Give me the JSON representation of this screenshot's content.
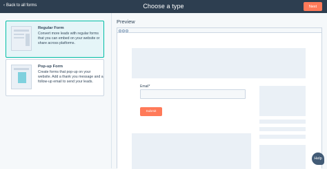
{
  "header": {
    "back_label": "Back to all forms",
    "title": "Choose a type",
    "next_label": "Next"
  },
  "form_types": [
    {
      "title": "Regular Form",
      "description": "Convert more leads with regular forms that you can embed on your website or share across platforms.",
      "selected": true
    },
    {
      "title": "Pop-up Form",
      "description": "Create forms that pop-up on your website. Add a thank you message and a follow-up email to send your leads.",
      "selected": false
    }
  ],
  "preview": {
    "title": "Preview",
    "email_label": "Email*",
    "submit_label": "Submit"
  },
  "help": {
    "label": "Help"
  },
  "colors": {
    "topbar": "#2d3e50",
    "accent": "#ff7a59",
    "selected_bg": "#e5f5f8",
    "selected_border": "#00bda5"
  }
}
